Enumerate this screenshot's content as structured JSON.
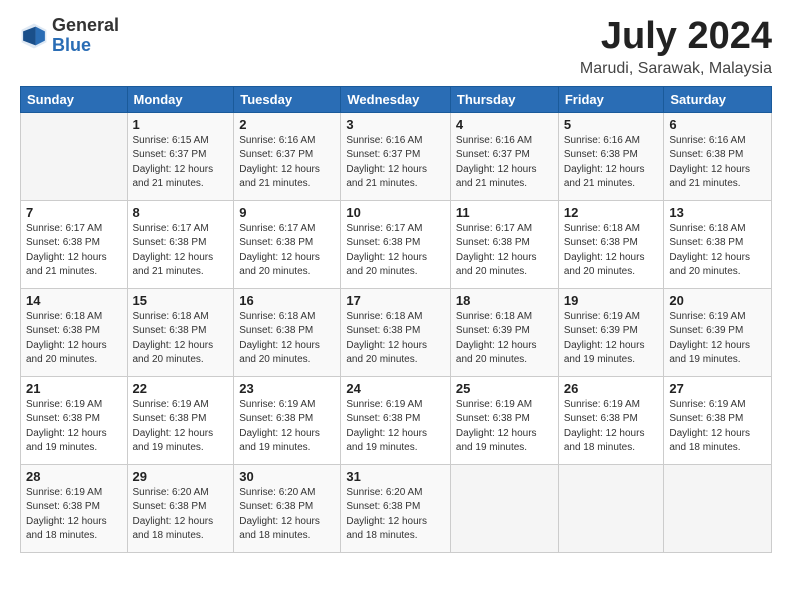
{
  "header": {
    "logo_line1": "General",
    "logo_line2": "Blue",
    "month": "July 2024",
    "location": "Marudi, Sarawak, Malaysia"
  },
  "weekdays": [
    "Sunday",
    "Monday",
    "Tuesday",
    "Wednesday",
    "Thursday",
    "Friday",
    "Saturday"
  ],
  "weeks": [
    [
      {
        "day": "",
        "info": ""
      },
      {
        "day": "1",
        "info": "Sunrise: 6:15 AM\nSunset: 6:37 PM\nDaylight: 12 hours\nand 21 minutes."
      },
      {
        "day": "2",
        "info": "Sunrise: 6:16 AM\nSunset: 6:37 PM\nDaylight: 12 hours\nand 21 minutes."
      },
      {
        "day": "3",
        "info": "Sunrise: 6:16 AM\nSunset: 6:37 PM\nDaylight: 12 hours\nand 21 minutes."
      },
      {
        "day": "4",
        "info": "Sunrise: 6:16 AM\nSunset: 6:37 PM\nDaylight: 12 hours\nand 21 minutes."
      },
      {
        "day": "5",
        "info": "Sunrise: 6:16 AM\nSunset: 6:38 PM\nDaylight: 12 hours\nand 21 minutes."
      },
      {
        "day": "6",
        "info": "Sunrise: 6:16 AM\nSunset: 6:38 PM\nDaylight: 12 hours\nand 21 minutes."
      }
    ],
    [
      {
        "day": "7",
        "info": "Sunrise: 6:17 AM\nSunset: 6:38 PM\nDaylight: 12 hours\nand 21 minutes."
      },
      {
        "day": "8",
        "info": "Sunrise: 6:17 AM\nSunset: 6:38 PM\nDaylight: 12 hours\nand 21 minutes."
      },
      {
        "day": "9",
        "info": "Sunrise: 6:17 AM\nSunset: 6:38 PM\nDaylight: 12 hours\nand 20 minutes."
      },
      {
        "day": "10",
        "info": "Sunrise: 6:17 AM\nSunset: 6:38 PM\nDaylight: 12 hours\nand 20 minutes."
      },
      {
        "day": "11",
        "info": "Sunrise: 6:17 AM\nSunset: 6:38 PM\nDaylight: 12 hours\nand 20 minutes."
      },
      {
        "day": "12",
        "info": "Sunrise: 6:18 AM\nSunset: 6:38 PM\nDaylight: 12 hours\nand 20 minutes."
      },
      {
        "day": "13",
        "info": "Sunrise: 6:18 AM\nSunset: 6:38 PM\nDaylight: 12 hours\nand 20 minutes."
      }
    ],
    [
      {
        "day": "14",
        "info": "Sunrise: 6:18 AM\nSunset: 6:38 PM\nDaylight: 12 hours\nand 20 minutes."
      },
      {
        "day": "15",
        "info": "Sunrise: 6:18 AM\nSunset: 6:38 PM\nDaylight: 12 hours\nand 20 minutes."
      },
      {
        "day": "16",
        "info": "Sunrise: 6:18 AM\nSunset: 6:38 PM\nDaylight: 12 hours\nand 20 minutes."
      },
      {
        "day": "17",
        "info": "Sunrise: 6:18 AM\nSunset: 6:38 PM\nDaylight: 12 hours\nand 20 minutes."
      },
      {
        "day": "18",
        "info": "Sunrise: 6:18 AM\nSunset: 6:39 PM\nDaylight: 12 hours\nand 20 minutes."
      },
      {
        "day": "19",
        "info": "Sunrise: 6:19 AM\nSunset: 6:39 PM\nDaylight: 12 hours\nand 19 minutes."
      },
      {
        "day": "20",
        "info": "Sunrise: 6:19 AM\nSunset: 6:39 PM\nDaylight: 12 hours\nand 19 minutes."
      }
    ],
    [
      {
        "day": "21",
        "info": "Sunrise: 6:19 AM\nSunset: 6:38 PM\nDaylight: 12 hours\nand 19 minutes."
      },
      {
        "day": "22",
        "info": "Sunrise: 6:19 AM\nSunset: 6:38 PM\nDaylight: 12 hours\nand 19 minutes."
      },
      {
        "day": "23",
        "info": "Sunrise: 6:19 AM\nSunset: 6:38 PM\nDaylight: 12 hours\nand 19 minutes."
      },
      {
        "day": "24",
        "info": "Sunrise: 6:19 AM\nSunset: 6:38 PM\nDaylight: 12 hours\nand 19 minutes."
      },
      {
        "day": "25",
        "info": "Sunrise: 6:19 AM\nSunset: 6:38 PM\nDaylight: 12 hours\nand 19 minutes."
      },
      {
        "day": "26",
        "info": "Sunrise: 6:19 AM\nSunset: 6:38 PM\nDaylight: 12 hours\nand 18 minutes."
      },
      {
        "day": "27",
        "info": "Sunrise: 6:19 AM\nSunset: 6:38 PM\nDaylight: 12 hours\nand 18 minutes."
      }
    ],
    [
      {
        "day": "28",
        "info": "Sunrise: 6:19 AM\nSunset: 6:38 PM\nDaylight: 12 hours\nand 18 minutes."
      },
      {
        "day": "29",
        "info": "Sunrise: 6:20 AM\nSunset: 6:38 PM\nDaylight: 12 hours\nand 18 minutes."
      },
      {
        "day": "30",
        "info": "Sunrise: 6:20 AM\nSunset: 6:38 PM\nDaylight: 12 hours\nand 18 minutes."
      },
      {
        "day": "31",
        "info": "Sunrise: 6:20 AM\nSunset: 6:38 PM\nDaylight: 12 hours\nand 18 minutes."
      },
      {
        "day": "",
        "info": ""
      },
      {
        "day": "",
        "info": ""
      },
      {
        "day": "",
        "info": ""
      }
    ]
  ]
}
